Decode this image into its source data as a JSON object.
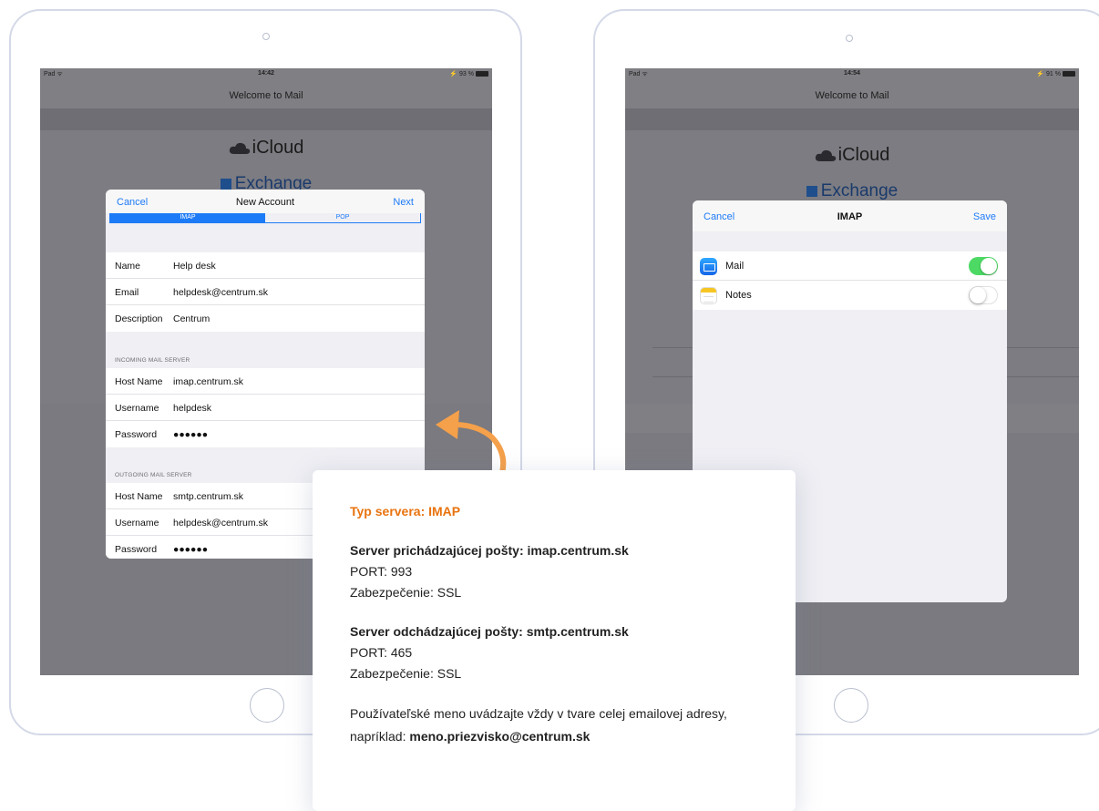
{
  "left_ipad": {
    "status": {
      "left": "Pad ᯤ",
      "time": "14:42",
      "right": "⚡ 93 %"
    },
    "title": "Welcome to Mail",
    "providers": {
      "icloud": "iCloud",
      "exchange": "Exchange"
    },
    "modal": {
      "cancel": "Cancel",
      "title": "New Account",
      "next": "Next",
      "segments": [
        "IMAP",
        "POP"
      ],
      "account_rows": [
        {
          "label": "Name",
          "value": "Help desk"
        },
        {
          "label": "Email",
          "value": "helpdesk@centrum.sk"
        },
        {
          "label": "Description",
          "value": "Centrum"
        }
      ],
      "incoming_label": "INCOMING MAIL SERVER",
      "incoming_rows": [
        {
          "label": "Host Name",
          "value": "imap.centrum.sk"
        },
        {
          "label": "Username",
          "value": "helpdesk"
        },
        {
          "label": "Password",
          "value": "●●●●●●"
        }
      ],
      "outgoing_label": "OUTGOING MAIL SERVER",
      "outgoing_rows": [
        {
          "label": "Host Name",
          "value": "smtp.centrum.sk"
        },
        {
          "label": "Username",
          "value": "helpdesk@centrum.sk"
        },
        {
          "label": "Password",
          "value": "●●●●●●"
        }
      ]
    }
  },
  "right_ipad": {
    "status": {
      "left": "Pad ᯤ",
      "time": "14:54",
      "right": "⚡ 91 %"
    },
    "title": "Welcome to Mail",
    "providers": {
      "icloud": "iCloud",
      "exchange": "Exchange"
    },
    "modal": {
      "cancel": "Cancel",
      "title": "IMAP",
      "save": "Save",
      "rows": [
        {
          "label": "Mail",
          "enabled": true
        },
        {
          "label": "Notes",
          "enabled": false
        }
      ]
    }
  },
  "info_card": {
    "heading": "Typ servera: IMAP",
    "incoming": {
      "title": "Server prichádzajúcej pošty: imap.centrum.sk",
      "port": "PORT: 993",
      "security": "Zabezpečenie: SSL"
    },
    "outgoing": {
      "title": "Server odchádzajúcej pošty: smtp.centrum.sk",
      "port": "PORT: 465",
      "security": "Zabezpečenie: SSL"
    },
    "note_text": "Používateľské meno uvádzajte vždy v tvare celej emailovej adresy, napríklad:",
    "note_example": "meno.priezvisko@centrum.sk"
  },
  "colors": {
    "accent_orange": "#e8730e",
    "ios_blue": "#1e7bf7",
    "toggle_green": "#4cd964"
  }
}
